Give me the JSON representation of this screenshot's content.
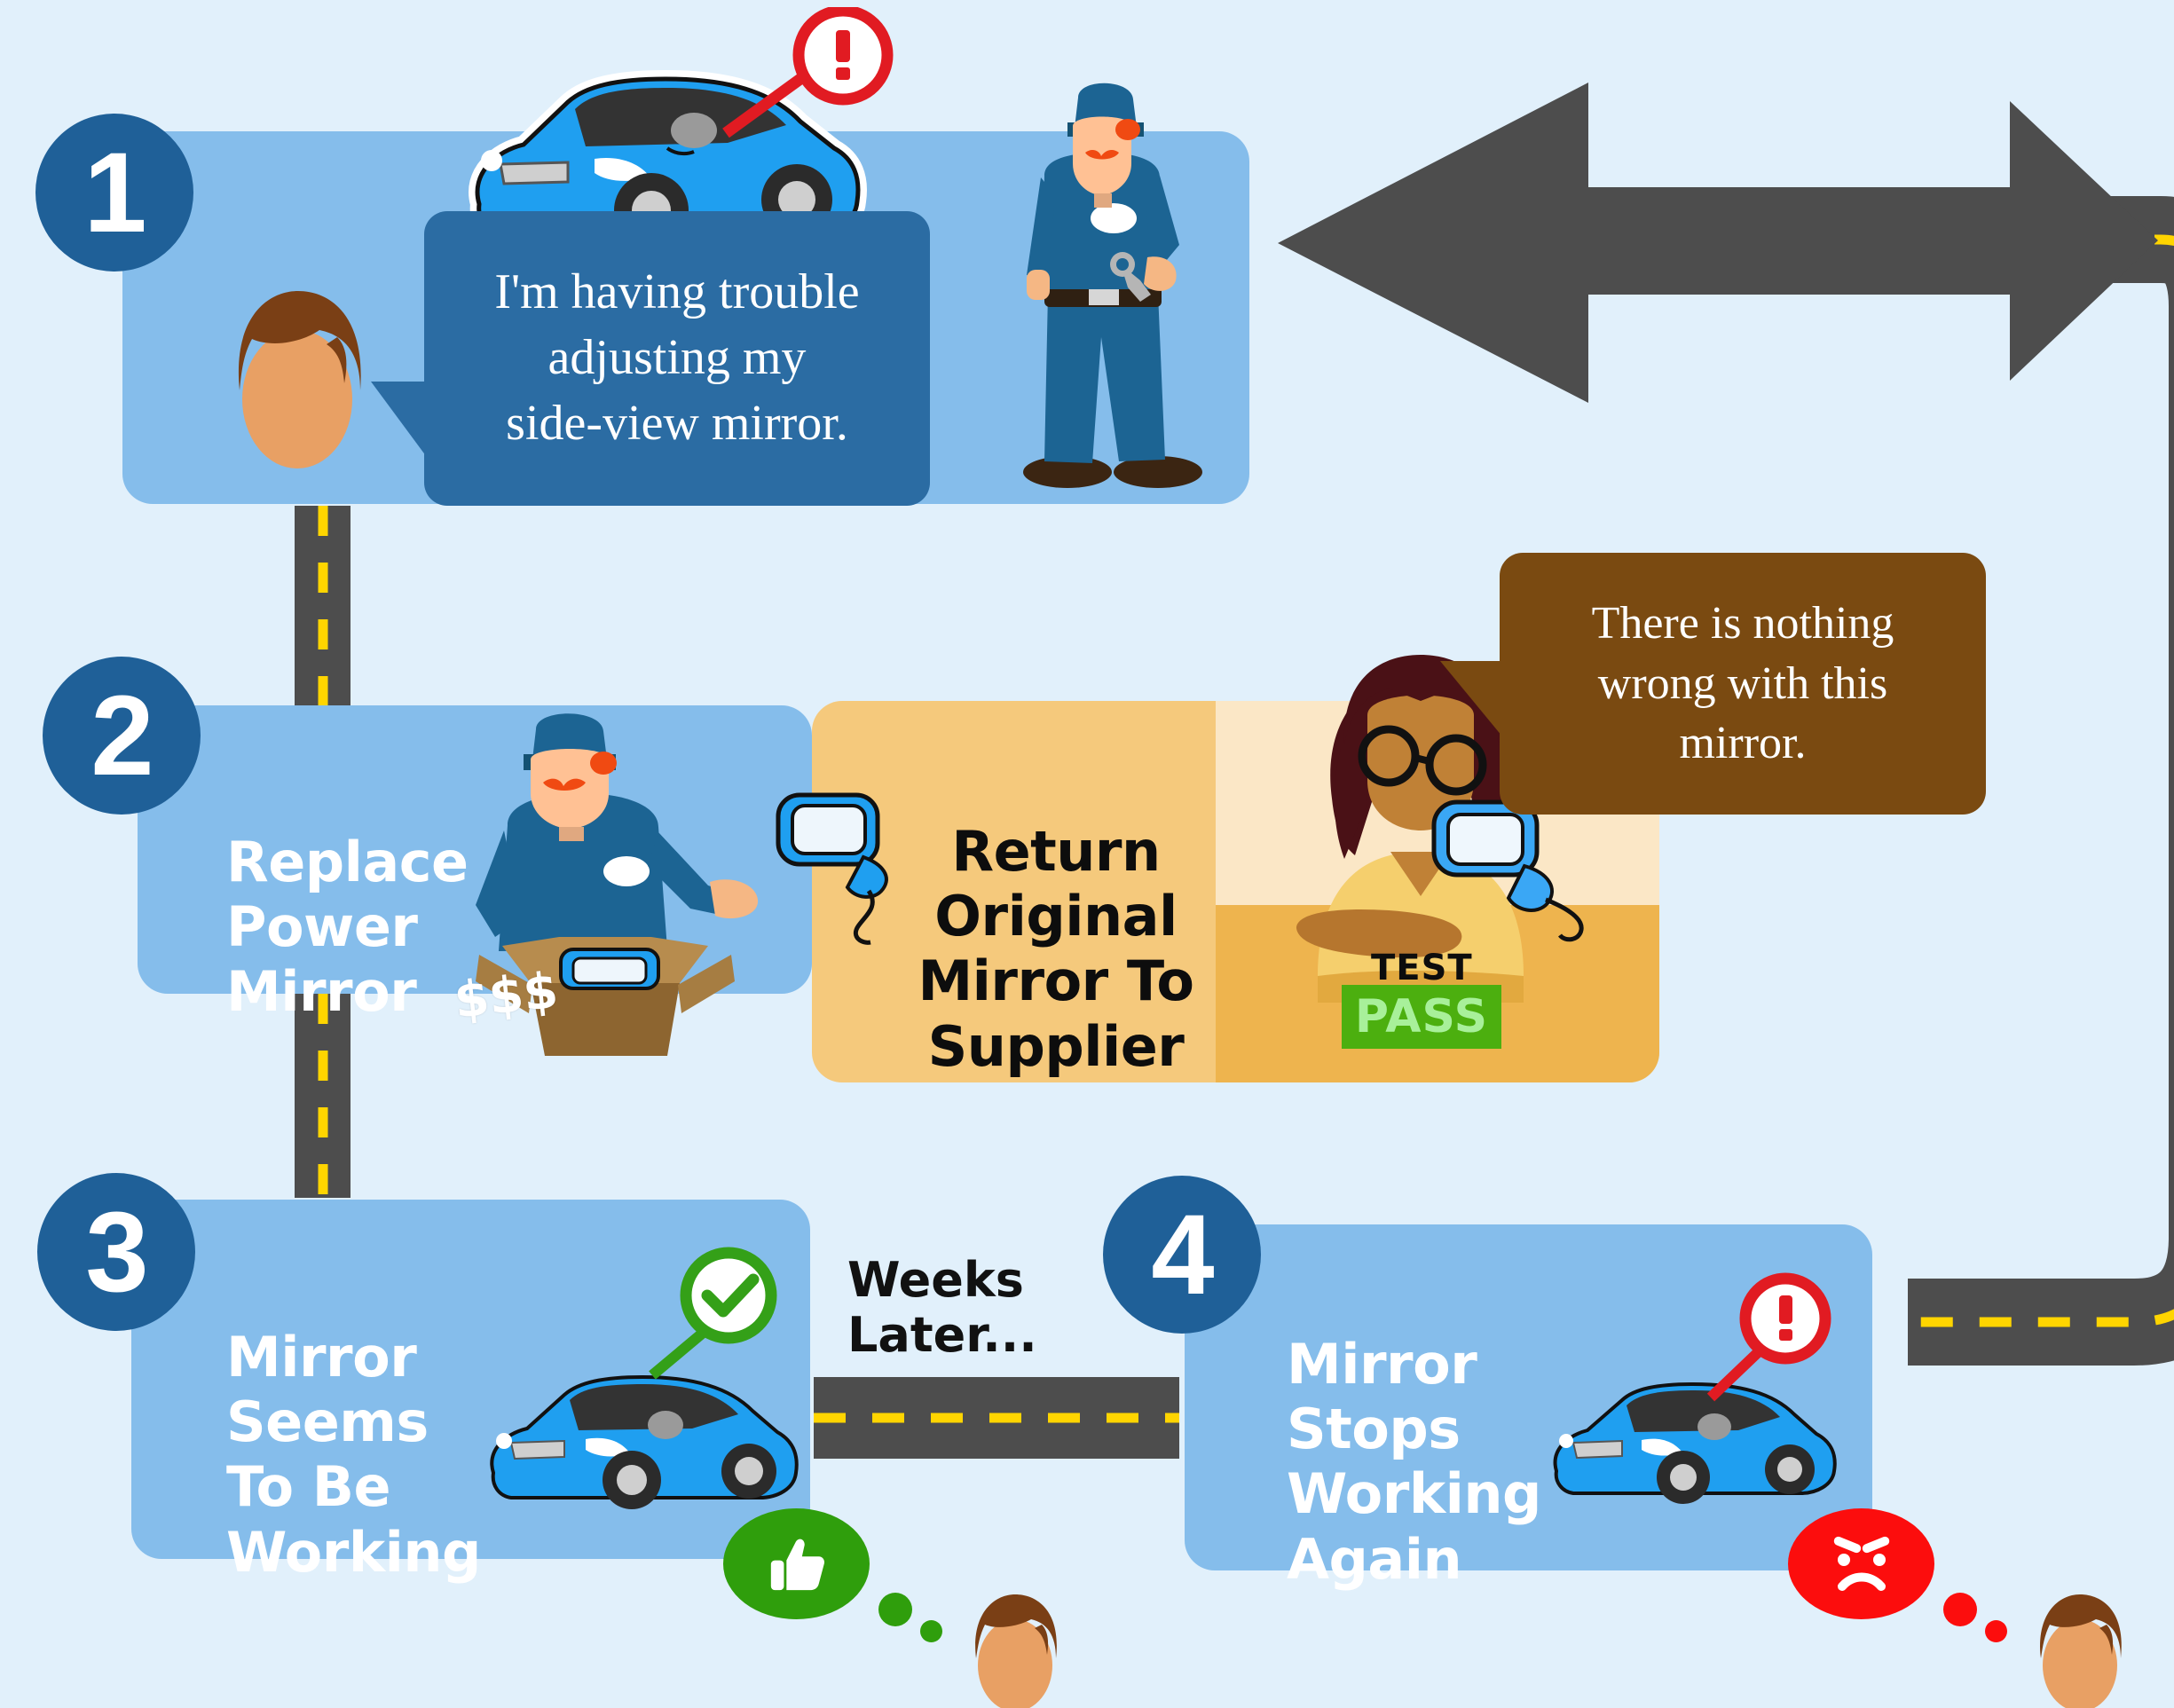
{
  "title": "Power Mirror Troubleshooting Loop Infographic",
  "background_color": "#e1f0fb",
  "accent_colors": {
    "panel_blue": "#85bdeb",
    "step_circle": "#1f6098",
    "bubble_blue": "#2b6ca3",
    "bubble_brown": "#7a4a11",
    "supplier_tan": "#f5c97c",
    "road_gray": "#4d4d4d",
    "road_line_yellow": "#ffd500",
    "pass_green": "#4caf0f",
    "check_green": "#34a018",
    "alert_red": "#e11b22",
    "angry_red": "#fc0d0d",
    "thumb_green": "#2f9e0c",
    "car_blue": "#1f9ff0"
  },
  "steps": [
    {
      "number": "1",
      "label": "",
      "speech": {
        "text": "I'm having trouble\nadjusting my\nside-view mirror.",
        "color": "#2b6ca3",
        "speaker": "customer"
      },
      "figures": [
        "customer-head",
        "mechanic-standing",
        "car-with-mirror-alert"
      ],
      "callout_icon": "alert-exclamation-icon"
    },
    {
      "number": "2",
      "label": "Replace\nPower\nMirror",
      "figures": [
        "mechanic-with-box",
        "cardboard-box",
        "money-cost"
      ],
      "cost_marker": "$$$"
    },
    {
      "number": "3",
      "label": "Mirror\nSeems\nTo Be\nWorking",
      "figures": [
        "blue-car",
        "green-check-callout"
      ],
      "callout_icon": "check-circle-icon",
      "reaction": {
        "type": "thumbs-up",
        "color": "#2f9e0c"
      }
    },
    {
      "number": "4",
      "label": "Mirror\nStops\nWorking\nAgain",
      "figures": [
        "blue-car",
        "red-alert-callout"
      ],
      "callout_icon": "alert-exclamation-icon",
      "reaction": {
        "type": "angry-face",
        "color": "#fc0d0d"
      }
    }
  ],
  "supplier_panel": {
    "label": "Return\nOriginal\nMirror To\nSupplier",
    "background": "#f5c97c",
    "figures": [
      "side-view-mirror",
      "technician-woman"
    ],
    "test": {
      "label": "TEST",
      "result": "PASS",
      "result_bg": "#4caf0f",
      "result_color": "#a8f09a"
    },
    "speech": {
      "text": "There is nothing\nwrong with this\nmirror.",
      "color": "#7a4a11",
      "speaker": "supplier-technician"
    }
  },
  "transition": {
    "text": "Weeks\nLater..."
  },
  "loop_arrow": {
    "direction": "left",
    "style": "road-with-dashed-center-line",
    "color": "#4d4d4d"
  }
}
